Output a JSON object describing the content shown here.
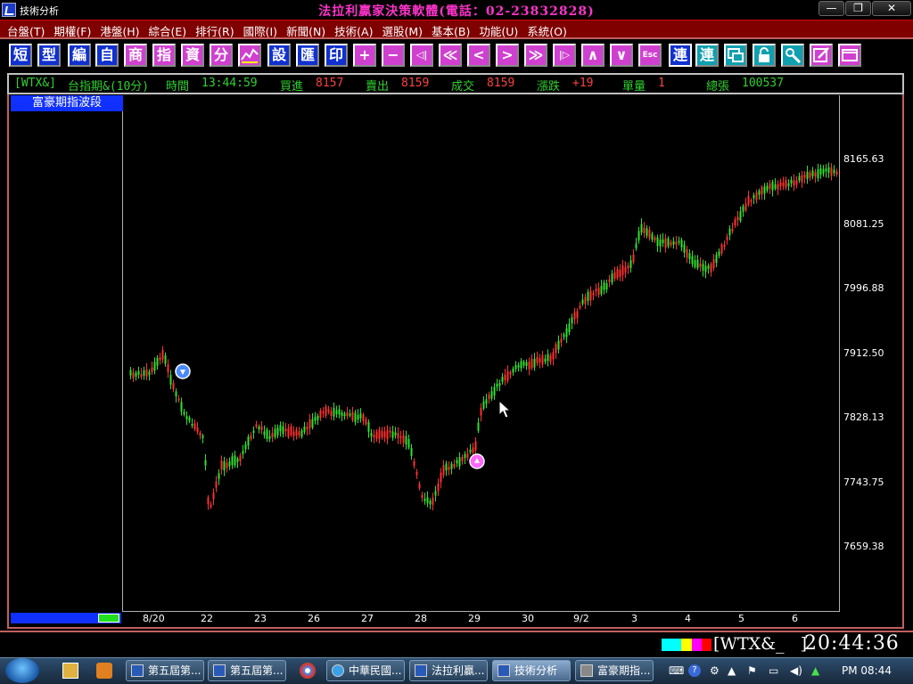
{
  "window": {
    "title": "技術分析",
    "app_title": "法拉利贏家決策軟體(電話：02-23832828)",
    "minimize": "—",
    "maximize": "❐",
    "close": "✕"
  },
  "menu": [
    "台盤(T)",
    "期權(F)",
    "港盤(H)",
    "綜合(E)",
    "排行(R)",
    "國際(I)",
    "新聞(N)",
    "技術(A)",
    "選股(M)",
    "基本(B)",
    "功能(U)",
    "系統(O)"
  ],
  "toolbar": {
    "text_buttons": [
      "短",
      "型",
      "編",
      "自",
      "商",
      "指",
      "資",
      "分"
    ],
    "set_buttons": [
      "設",
      "匯",
      "印"
    ],
    "connect_buttons": [
      "連",
      "連"
    ],
    "nav_glyphs": [
      "+",
      "−",
      "◁|",
      "≪",
      "<",
      ">",
      "≫",
      "|▷",
      "∧",
      "∨",
      "Esc"
    ]
  },
  "quote": {
    "symbol": "[WTX&]",
    "name": "台指期&(10分)",
    "time_label": "時間",
    "time": "13:44:59",
    "bid_label": "買進",
    "bid": "8157",
    "ask_label": "賣出",
    "ask": "8159",
    "last_label": "成交",
    "last": "8159",
    "change_label": "漲跌",
    "change": "+19",
    "volume_label": "單量",
    "volume": "1",
    "total_label": "總張",
    "total": "100537"
  },
  "chart": {
    "panel_title": "富豪期指波段",
    "price_labels": [
      "8165.63",
      "8081.25",
      "7996.88",
      "7912.50",
      "7828.13",
      "7743.75",
      "7659.38"
    ],
    "date_labels": [
      "8/20",
      "22",
      "23",
      "26",
      "27",
      "28",
      "29",
      "30",
      "9/2",
      "3",
      "4",
      "5",
      "6"
    ],
    "up_color": "#30e030",
    "down_color": "#ff3030",
    "buy_marker_color": "#ff66ff",
    "sell_marker_color": "#4a8aff"
  },
  "status": {
    "symbol": "[WTX&_   ]",
    "time": "20:44:36",
    "swatches": [
      "#00ffff",
      "#00ffff",
      "#ffff00",
      "#ff00ff",
      "#ff0000"
    ]
  },
  "taskbar": {
    "tasks": [
      "第五屆第...",
      "第五屆第...",
      "中華民國...",
      "法拉利贏...",
      "技術分析",
      "富豪期指..."
    ],
    "clock": "PM 08:44"
  }
}
